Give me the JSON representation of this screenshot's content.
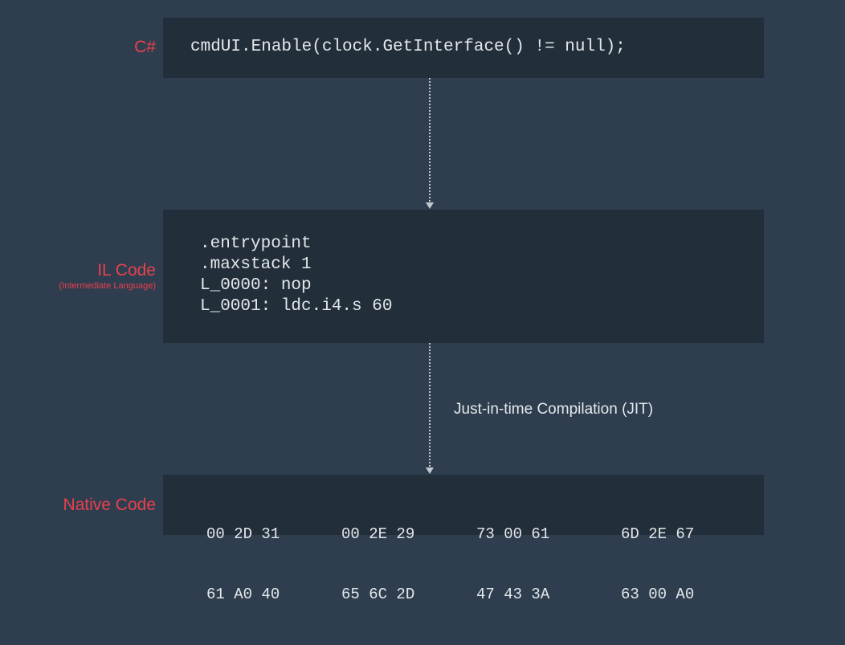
{
  "stages": {
    "csharp": {
      "label": "C#",
      "code": "cmdUI.Enable(clock.GetInterface() != null);"
    },
    "il": {
      "label": "IL Code",
      "sublabel": "(Intermediate Language)",
      "lines": [
        ".entrypoint",
        ".maxstack 1",
        "L_0000: nop",
        "L_0001: ldc.i4.s 60"
      ]
    },
    "native": {
      "label": "Native Code",
      "columns": [
        [
          "00 2D 31",
          "61 A0 40"
        ],
        [
          "00 2E 29",
          "65 6C 2D"
        ],
        [
          "73 00 61",
          "47 43 3A"
        ],
        [
          "6D 2E 67",
          "63 00 A0"
        ]
      ]
    }
  },
  "arrows": {
    "jit_label": "Just-in-time Compilation (JIT)"
  }
}
